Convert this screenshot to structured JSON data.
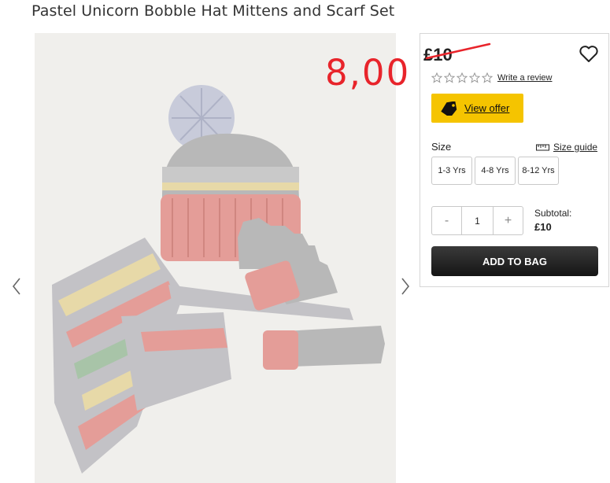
{
  "product": {
    "title": "Pastel Unicorn Bobble Hat Mittens and Scarf Set",
    "image_description": "Pastel unicorn knit bobble hat, gloves and scarf set"
  },
  "annotation": {
    "new_price": "8,00"
  },
  "pricing": {
    "old_price": "£10"
  },
  "reviews": {
    "star_count": 5,
    "write_review_label": "Write a review"
  },
  "offer": {
    "label": "View offer"
  },
  "size": {
    "label": "Size",
    "guide_label": "Size guide",
    "options": [
      "1-3 Yrs",
      "4-8 Yrs",
      "8-12 Yrs"
    ]
  },
  "quantity": {
    "decrement": "-",
    "value": "1",
    "increment": "+"
  },
  "subtotal": {
    "label": "Subtotal:",
    "value": "£10"
  },
  "cart": {
    "add_label": "ADD TO BAG"
  },
  "colors": {
    "offer_yellow": "#f5c400",
    "annotation_red": "#e8242b",
    "button_dark": "#1f1f1f"
  }
}
